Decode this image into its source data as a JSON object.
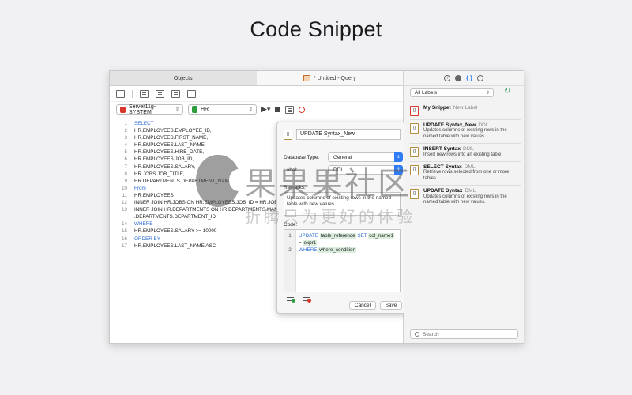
{
  "page_title": "Code Snippet",
  "tabs": [
    {
      "label": "Objects"
    },
    {
      "label": "* Untitled - Query"
    }
  ],
  "toolbar2": {
    "connection": "Server11g-SYSTEM",
    "schema": "HR"
  },
  "editor": {
    "line_numbers": [
      "1",
      "2",
      "3",
      "4",
      "5",
      "6",
      "7",
      "8",
      "9",
      "10",
      "11",
      "12",
      "13",
      "",
      "14",
      "15",
      "16",
      "17"
    ],
    "lines": [
      "SELECT",
      "HR.EMPLOYEES.EMPLOYEE_ID,",
      "HR.EMPLOYEES.FIRST_NAME,",
      "HR.EMPLOYEES.LAST_NAME,",
      "HR.EMPLOYEES.HIRE_DATE,",
      "HR.EMPLOYEES.JOB_ID,",
      "HR.EMPLOYEES.SALARY,",
      "HR.JOBS.JOB_TITLE,",
      "HR.DEPARTMENTS.DEPARTMENT_NAME",
      "From",
      "HR.EMPLOYEES",
      "INNER JOIN HR.JOBS ON HR.EMPLOYEES.JOB_ID = HR.JOBS.JOB",
      "INNER JOIN HR.DEPARTMENTS ON HR.DEPARTMENTS.MANAGER",
      ".DEPARTMENTS.DEPARTMENT_ID",
      "WHERE",
      "HR.EMPLOYEES.SALARY >= 10000",
      "ORDER BY",
      "HR.EMPLOYEES.LAST_NAME ASC"
    ]
  },
  "popover": {
    "name": "UPDATE Syntax_New",
    "database_type_label": "Database Type:",
    "database_type": "General",
    "label_label": "Label:",
    "label_value": "DDL",
    "remarks_label": "Remarks:",
    "remarks": "Updates columns of existing rows in the named table with new values.",
    "code_label": "Code:",
    "code_lines": [
      {
        "num": "1",
        "kw1": "UPDATE",
        "p1": "table_reference",
        "kw2": "SET",
        "p2": "col_name1",
        "eq": "=",
        "p3": "expr1"
      },
      {
        "num": "2",
        "kw1": "WHERE",
        "p1": "where_condition"
      }
    ],
    "cancel": "Cancel",
    "save": "Save"
  },
  "right_pane": {
    "filter": "All Labels",
    "search_placeholder": "Search",
    "items": [
      {
        "title": "My Snippet",
        "tag": "New Label",
        "desc": ""
      },
      {
        "title": "UPDATE Syntax_New",
        "tag": "DDL",
        "desc": "Updates columns of existing rows in the named table with new values."
      },
      {
        "title": "INSERT Syntax",
        "tag": "DML",
        "desc": "Insert new rows into an existing table."
      },
      {
        "title": "SELECT Syntax",
        "tag": "DML",
        "desc": "Retrieve rows selected from one or more tables."
      },
      {
        "title": "UPDATE Syntax",
        "tag": "DML",
        "desc": "Updates columns of existing rows in the named table with new values."
      }
    ]
  },
  "watermark": {
    "line1": "果果果社区",
    "line2": "折腾只为更好的体验"
  }
}
